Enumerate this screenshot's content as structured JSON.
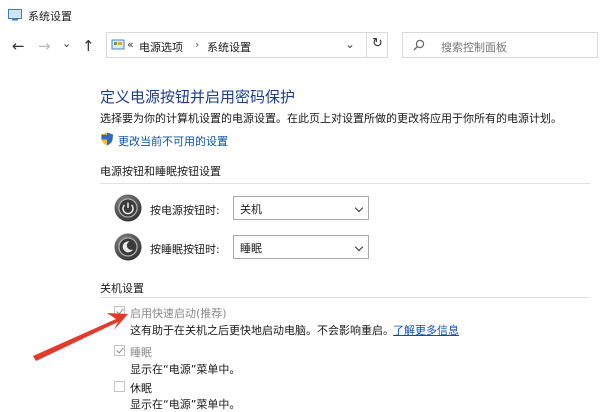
{
  "window": {
    "title": "系统设置"
  },
  "nav": {
    "back": "←",
    "forward": "→",
    "recent": "⌄",
    "up": "↑",
    "breadcrumb_prefix": "«",
    "crumb_1": "电源选项",
    "crumb_sep": "›",
    "crumb_2": "系统设置",
    "dropdown": "⌄",
    "refresh": "↻",
    "search_placeholder": "搜索控制面板"
  },
  "page": {
    "heading": "定义电源按钮并启用密码保护",
    "description": "选择要为你的计算机设置的电源设置。在此页上对设置所做的更改将应用于你所有的电源计划。",
    "change_unavailable": "更改当前不可用的设置"
  },
  "buttons_section": {
    "title": "电源按钮和睡眠按钮设置",
    "power_label": "按电源按钮时:",
    "power_value": "关机",
    "sleep_label": "按睡眠按钮时:",
    "sleep_value": "睡眠"
  },
  "shutdown_section": {
    "title": "关机设置",
    "fast_startup": {
      "label": "启用快速启动(推荐)",
      "checked": true,
      "desc": "这有助于在关机之后更快地启动电脑。不会影响重启。",
      "link": "了解更多信息"
    },
    "sleep": {
      "label": "睡眠",
      "checked": true,
      "desc": "显示在“电源”菜单中。"
    },
    "hibernate": {
      "label": "休眠",
      "checked": false,
      "desc": "显示在“电源”菜单中。"
    }
  },
  "colors": {
    "heading": "#1d3d8f",
    "link": "#0a50b0",
    "arrow": "#e23b2c"
  }
}
